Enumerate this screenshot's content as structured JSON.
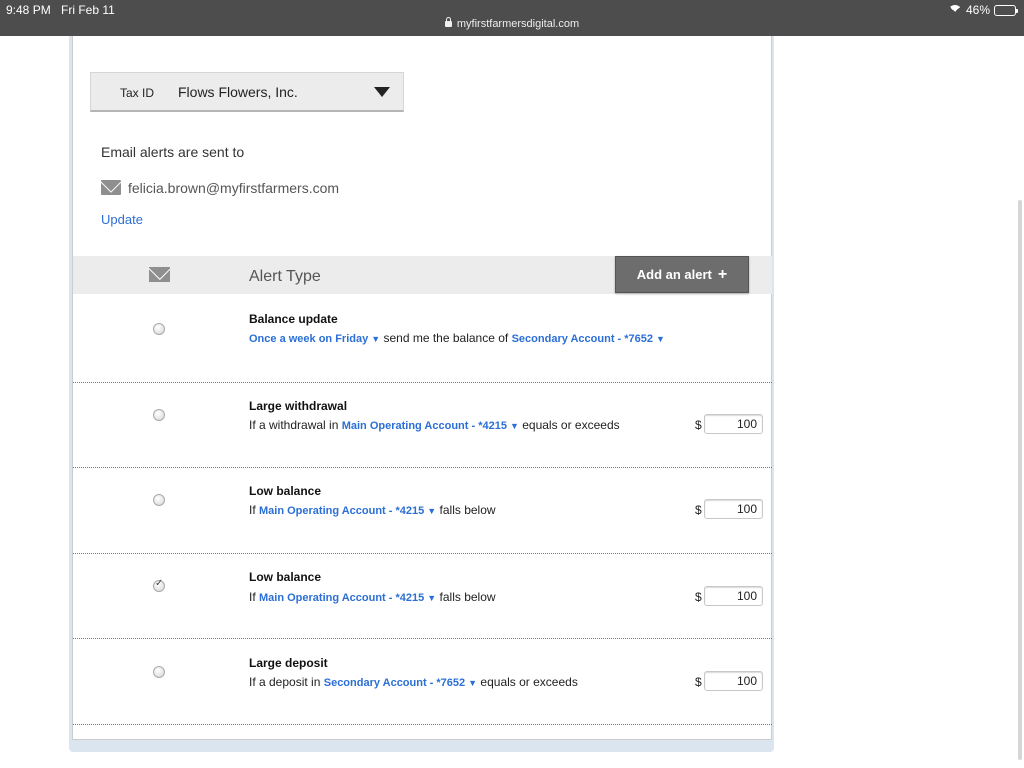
{
  "status_bar": {
    "time": "9:48 PM",
    "date": "Fri Feb 11",
    "url": "myfirstfarmersdigital.com",
    "battery": "46%"
  },
  "tax_id": {
    "label": "Tax ID",
    "value": "Flows Flowers, Inc."
  },
  "email": {
    "heading": "Email alerts are sent to",
    "address": "felicia.brown@myfirstfarmers.com",
    "update_label": "Update"
  },
  "alerts_table": {
    "header_label": "Alert Type",
    "add_button_label": "Add an alert",
    "rows": [
      {
        "title": "Balance update",
        "frequency": "Once a week on Friday",
        "text_mid": "send me the balance of",
        "account": "Secondary Account - *7652",
        "checked": false
      },
      {
        "title": "Large withdrawal",
        "text_pre": "If a withdrawal in",
        "account": "Main Operating Account - *4215",
        "text_post": "equals or exceeds",
        "currency": "$",
        "amount": "100",
        "checked": false
      },
      {
        "title": "Low balance",
        "text_pre": "If",
        "account": "Main Operating Account - *4215",
        "text_post": "falls below",
        "currency": "$",
        "amount": "100",
        "checked": false
      },
      {
        "title": "Low balance",
        "text_pre": "If",
        "account": "Main Operating Account - *4215",
        "text_post": "falls below",
        "currency": "$",
        "amount": "100",
        "checked": true
      },
      {
        "title": "Large deposit",
        "text_pre": "If a deposit in",
        "account": "Secondary Account - *7652",
        "text_post": "equals or exceeds",
        "currency": "$",
        "amount": "100",
        "checked": false
      }
    ]
  }
}
